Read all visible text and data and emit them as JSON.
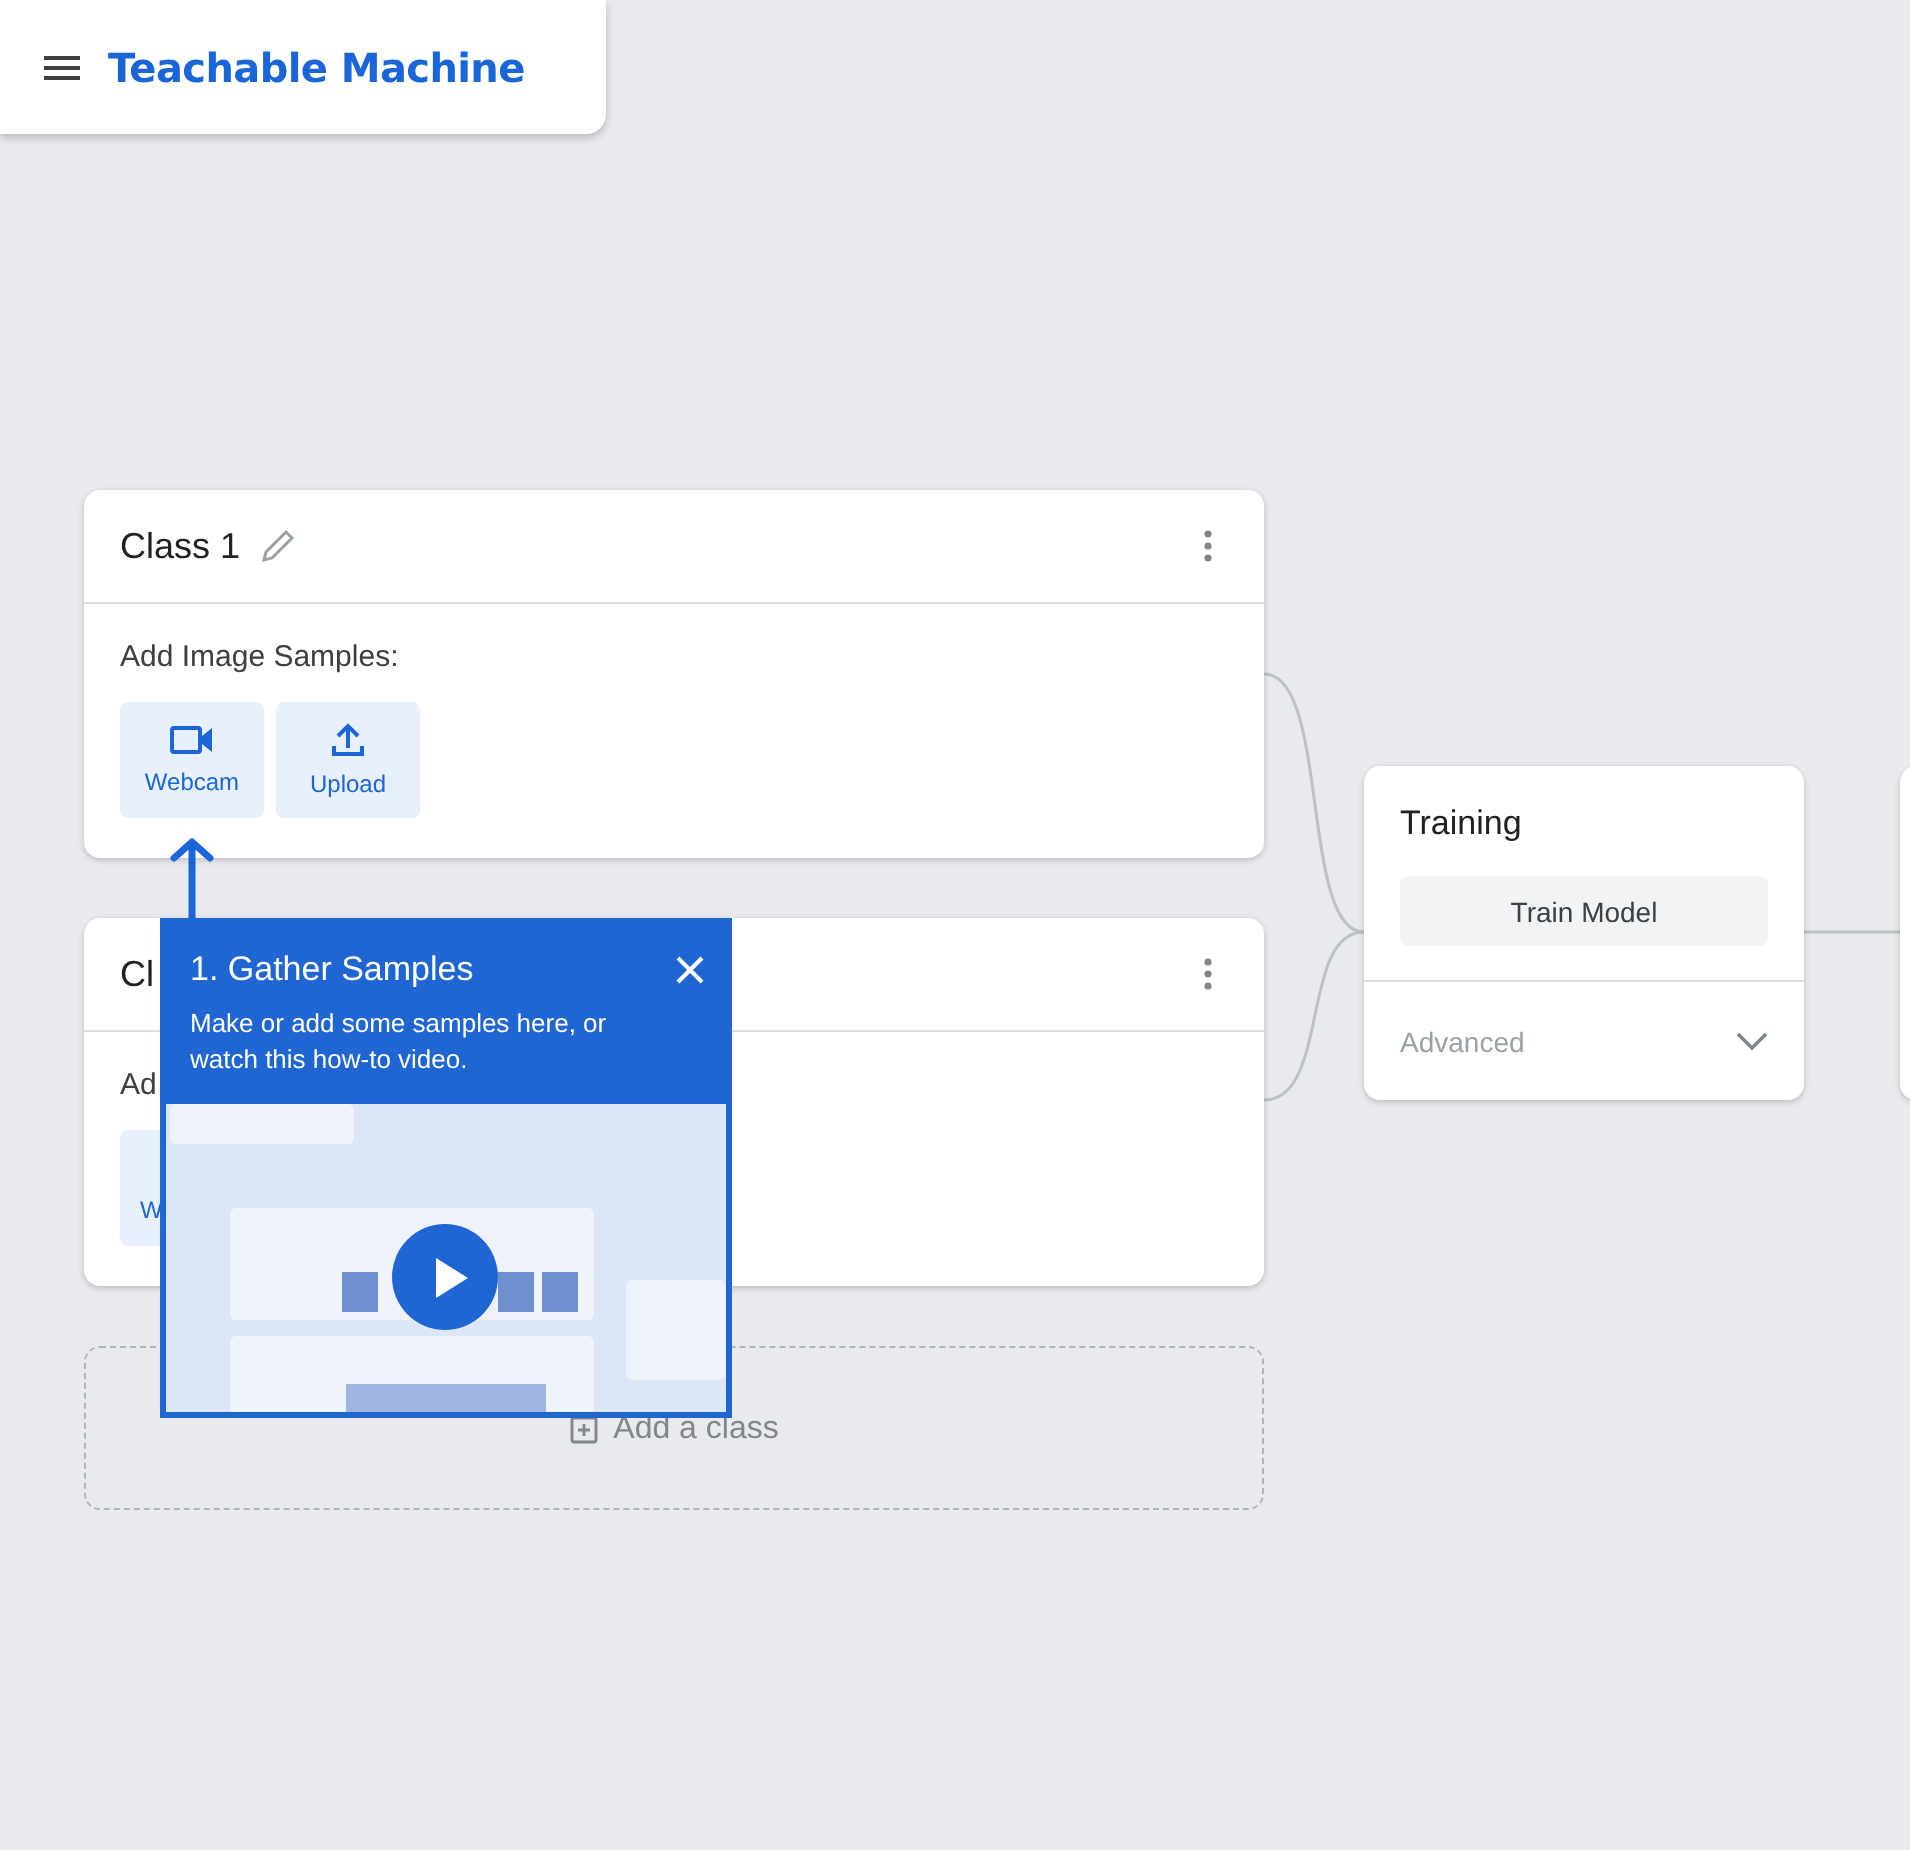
{
  "header": {
    "title": "Teachable Machine"
  },
  "classes": [
    {
      "name": "Class 1",
      "editable": true,
      "samples_label": "Add Image Samples:",
      "buttons": [
        {
          "kind": "webcam",
          "label": "Webcam"
        },
        {
          "kind": "upload",
          "label": "Upload"
        }
      ]
    },
    {
      "name": "Cl",
      "samples_label": "Ad",
      "buttons": [
        {
          "label": "W"
        }
      ]
    }
  ],
  "add_class": {
    "label": "Add a class"
  },
  "training": {
    "title": "Training",
    "button": "Train Model",
    "advanced": "Advanced",
    "expanded": false
  },
  "tooltip": {
    "title": "1. Gather Samples",
    "text": "Make or add some samples here, or watch this how-to video."
  }
}
